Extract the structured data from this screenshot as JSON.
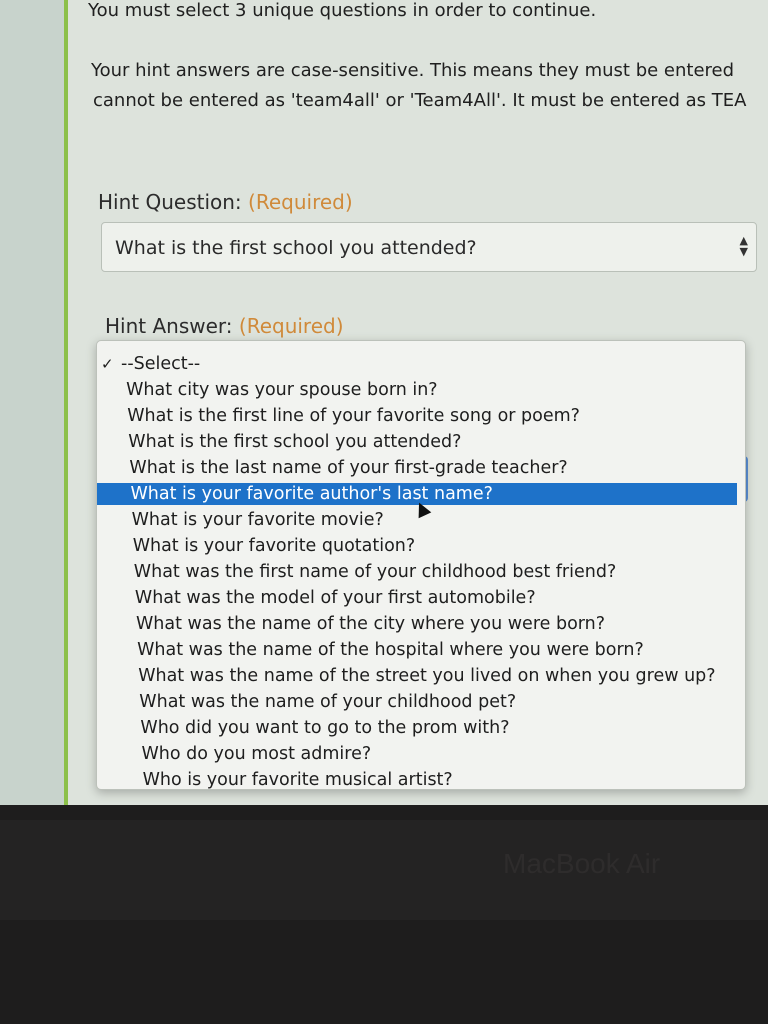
{
  "notice": "You must select 3 unique questions in order to continue.",
  "paragraph_line1": "Your hint answers are case-sensitive. This means they must be entered",
  "paragraph_line2": "cannot be entered as 'team4all' or 'Team4All'. It must be entered as TEA",
  "hint_question": {
    "label": "Hint Question:",
    "required": "(Required)",
    "selected_value": "What is the first school you attended?"
  },
  "hint_answer": {
    "label": "Hint Answer:",
    "required": "(Required)"
  },
  "dropdown": {
    "checkmark": "✓",
    "highlighted_option": "What is your favorite author's last name?",
    "options": [
      "--Select--",
      "What city was your spouse born in?",
      "What is the first line of your favorite song or poem?",
      "What is the first school you attended?",
      "What is the last name of your first-grade teacher?",
      "What is your favorite author's last name?",
      "What is your favorite movie?",
      "What is your favorite quotation?",
      "What was the first name of your childhood best friend?",
      "What was the model of your first automobile?",
      "What was the name of the city where you were born?",
      "What was the name of the hospital where you were born?",
      "What was the name of the street you lived on when you grew up?",
      "What was the name of your childhood pet?",
      "Who did you want to go to the prom with?",
      "Who do you most admire?",
      "Who is your favorite musical artist?"
    ]
  },
  "device_brand": "MacBook Air",
  "colors": {
    "required": "#d08a3a",
    "highlight": "#1e72c9",
    "accent_rule": "#8cc04a"
  }
}
